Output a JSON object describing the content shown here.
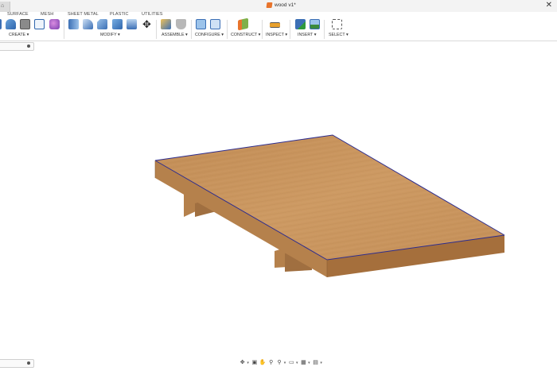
{
  "app": {
    "document_title": "wood v1*"
  },
  "ribbon": {
    "tabs": [
      "SURFACE",
      "MESH",
      "SHEET METAL",
      "PLASTIC",
      "UTILITIES"
    ],
    "groups": [
      "CREATE ▾",
      "MODIFY ▾",
      "ASSEMBLE ▾",
      "CONFIGURE ▾",
      "CONSTRUCT ▾",
      "INSPECT ▾",
      "INSERT ▾",
      "SELECT ▾"
    ]
  },
  "icons": {
    "home": "home-icon",
    "close": "close-icon",
    "doc": "document-icon",
    "browser_toggle": "circle-icon",
    "nav": [
      "orbit-icon",
      "look-at-icon",
      "pan-icon",
      "zoom-icon",
      "fit-icon",
      "display-settings-icon",
      "grid-icon",
      "viewports-icon"
    ]
  },
  "glyphs": {
    "home": "⌂",
    "close": "✕",
    "orbit": "✥",
    "look": "▣",
    "pan": "✋",
    "zoom": "⚲",
    "fit": "⚲",
    "display": "▭",
    "grid": "▦",
    "viewports": "▤",
    "caret": "▾"
  },
  "colors": {
    "accent_orange": "#e8742c",
    "edge_highlight": "#2d2d8f",
    "wood_top": "#c8955d",
    "wood_side": "#b5814c",
    "wood_end": "#a06f40"
  }
}
